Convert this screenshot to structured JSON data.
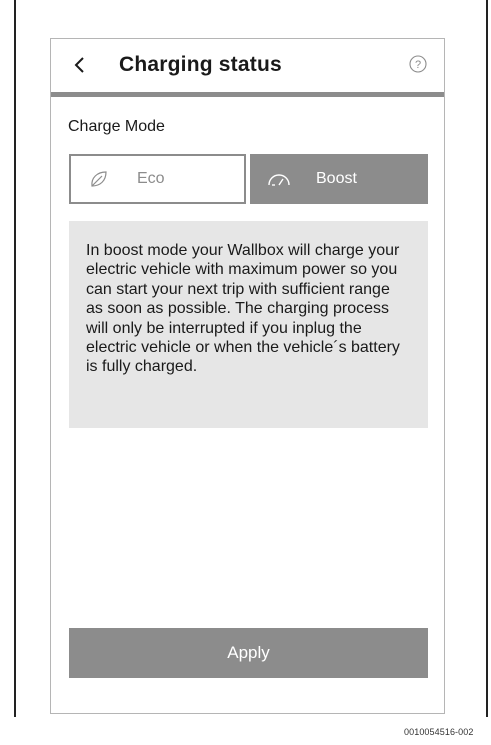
{
  "header": {
    "back_icon": "chevron-left-icon",
    "back_glyph": "<",
    "title": "Charging status",
    "help_icon": "help-circle-icon",
    "help_glyph": "?"
  },
  "charge_mode": {
    "label": "Charge Mode",
    "options": [
      {
        "label": "Eco",
        "icon": "leaf-icon",
        "selected": false
      },
      {
        "label": "Boost",
        "icon": "speedometer-icon",
        "selected": true
      }
    ]
  },
  "info": {
    "text": "In boost mode your Wallbox will charge your electric vehicle with maximum power so you can start your next trip with sufficient range as soon as possible. The charging process will only be interrupted if you inplug the electric vehicle or when the vehicle´s battery is fully charged."
  },
  "apply_label": "Apply",
  "figure_ref": "0010054516-002",
  "colors": {
    "accent_gray": "#8c8c8c",
    "info_bg": "#e6e6e6",
    "text": "#1a1a1a"
  }
}
